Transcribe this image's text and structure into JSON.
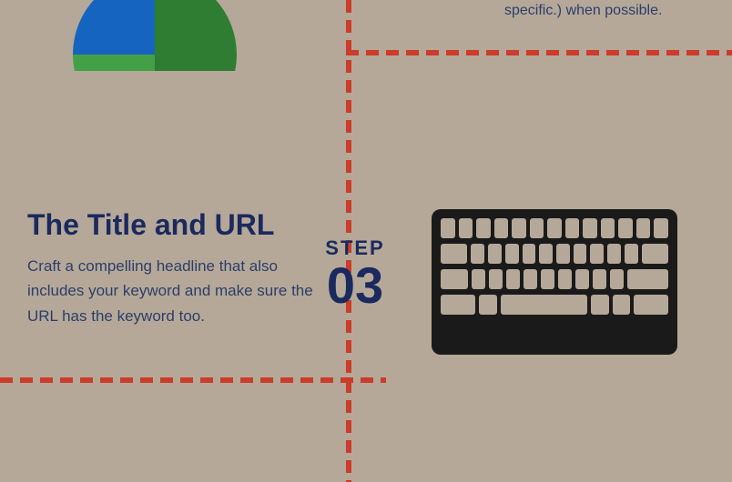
{
  "background_color": "#b5a898",
  "top_right_text": "specific.) when possible.",
  "section": {
    "title": "The Title and URL",
    "body": "Craft a compelling headline that also includes your keyword and make sure the URL has the keyword too."
  },
  "step": {
    "label": "STEP",
    "number": "03"
  },
  "keyboard_label": "keyboard-illustration",
  "circle_label": "decorative-circle"
}
